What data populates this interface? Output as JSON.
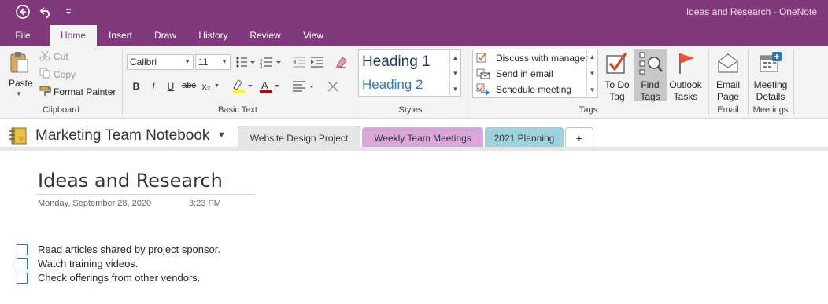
{
  "window": {
    "title": "Ideas and Research - OneNote"
  },
  "quick_access": {
    "back_icon": "back-icon",
    "undo_icon": "undo-icon",
    "customize_icon": "customize-qat-icon"
  },
  "ribbon_tabs": [
    "File",
    "Home",
    "Insert",
    "Draw",
    "History",
    "Review",
    "View"
  ],
  "active_tab": "Home",
  "clipboard": {
    "paste_label": "Paste",
    "cut_label": "Cut",
    "copy_label": "Copy",
    "format_painter_label": "Format Painter",
    "group_label": "Clipboard"
  },
  "basic_text": {
    "font_name": "Calibri",
    "font_size": "11",
    "bold": "B",
    "italic": "I",
    "underline": "U",
    "strikethrough": "abc",
    "subscript": "x₂",
    "group_label": "Basic Text"
  },
  "styles": {
    "heading1": "Heading 1",
    "heading2": "Heading 2",
    "group_label": "Styles"
  },
  "tags": {
    "items": [
      "Discuss with manager",
      "Send in email",
      "Schedule meeting"
    ],
    "todo_tag_label": "To Do Tag",
    "find_tags_label": "Find Tags",
    "outlook_tasks_label": "Outlook Tasks",
    "group_label": "Tags"
  },
  "email": {
    "email_page_label": "Email Page",
    "group_label": "Email"
  },
  "meetings": {
    "meeting_details_label": "Meeting Details",
    "group_label": "Meetings"
  },
  "notebook": {
    "name": "Marketing Team Notebook",
    "sections": [
      {
        "label": "Website Design Project",
        "color": "#e6e6e6"
      },
      {
        "label": "Weekly Team Meetings",
        "color": "#dba7db"
      },
      {
        "label": "2021 Planning",
        "color": "#9ed2e0"
      }
    ],
    "add_section": "+"
  },
  "page": {
    "title": "Ideas and Research",
    "date": "Monday, September 28, 2020",
    "time": "3:23 PM",
    "todos": [
      "Read articles shared by project sponsor.",
      "Watch training videos.",
      "Check offerings from other vendors."
    ]
  },
  "colors": {
    "brand": "#80397b",
    "ribbon_bg": "#f3f3f3",
    "checkbox": "#2e75b6"
  }
}
